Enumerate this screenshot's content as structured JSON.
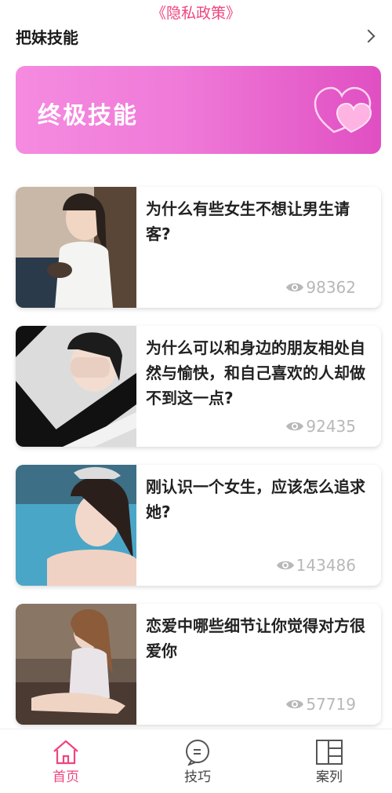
{
  "header": {
    "privacy_link": "《隐私政策》",
    "section_title": "把妹技能"
  },
  "banner": {
    "title": "终极技能"
  },
  "articles": [
    {
      "title": "为什么有些女生不想让男生请客?",
      "views": "98362"
    },
    {
      "title": "为什么可以和身边的朋友相处自然与愉快，和自己喜欢的人却做不到这一点?",
      "views": "92435"
    },
    {
      "title": "刚认识一个女生，应该怎么追求她?",
      "views": "143486"
    },
    {
      "title": "恋爱中哪些细节让你觉得对方很爱你",
      "views": "57719"
    }
  ],
  "tabbar": {
    "tabs": [
      {
        "label": "首页",
        "icon": "home-icon"
      },
      {
        "label": "技巧",
        "icon": "chat-icon"
      },
      {
        "label": "案列",
        "icon": "layout-icon"
      }
    ],
    "active_color": "#f0457f"
  }
}
